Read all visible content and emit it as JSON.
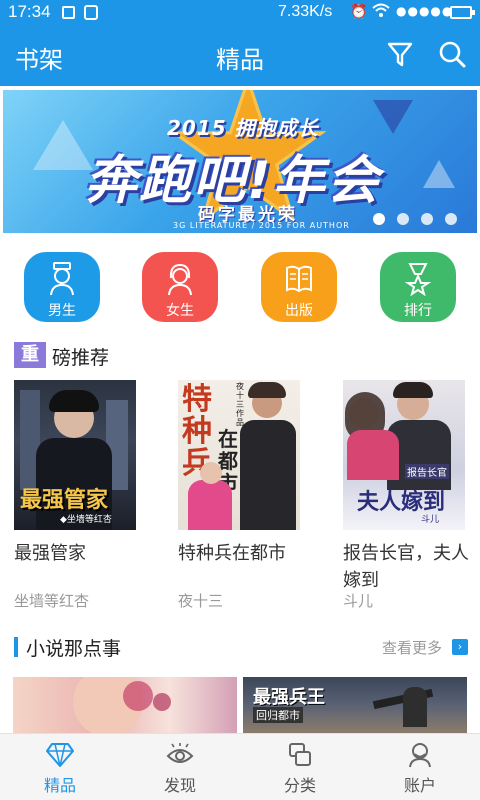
{
  "status_bar": {
    "time": "17:34",
    "network_speed": "7.33K/s",
    "signal": "●●●●●"
  },
  "app_bar": {
    "shelf_label": "书架",
    "title": "精品",
    "filter_icon": "filter-icon",
    "search_icon": "search-icon",
    "color": "#1e96e8"
  },
  "banner": {
    "headline_small": "2015 拥抱成长",
    "headline_main": "奔跑吧!年会",
    "subtitle": "码字最光荣",
    "tagline": "3G LITERATURE / 2015  FOR AUTHOR",
    "page_count": 4,
    "active_page": 1
  },
  "categories": [
    {
      "label": "男生",
      "color": "#1e9be6",
      "icon": "male-avatar-icon"
    },
    {
      "label": "女生",
      "color": "#f4544f",
      "icon": "female-avatar-icon"
    },
    {
      "label": "出版",
      "color": "#f9a01b",
      "icon": "book-icon"
    },
    {
      "label": "排行",
      "color": "#3fba6a",
      "icon": "medal-icon"
    }
  ],
  "recommend": {
    "tag": "重",
    "title_rest": "磅推荐",
    "books": [
      {
        "title": "最强管家",
        "author": "坐墙等红杏",
        "cover_text": "最强管家",
        "cover_small": "◆坐墙等红杏"
      },
      {
        "title": "特种兵在都市",
        "author": "夜十三",
        "cover_text": "特种兵",
        "cover_text2": "在都市",
        "cover_small": "夜十三作品"
      },
      {
        "title": "报告长官，夫人嫁到",
        "author": "斗儿",
        "cover_text": "夫人嫁到",
        "cover_small": "报告长官",
        "cover_author": "斗儿"
      }
    ]
  },
  "stories": {
    "title": "小说那点事",
    "more_label": "查看更多",
    "items": [
      {
        "text": ""
      },
      {
        "text": "最强兵王",
        "sub": "回归都市"
      }
    ]
  },
  "bottom_nav": [
    {
      "label": "精品",
      "icon": "diamond-icon",
      "active": true
    },
    {
      "label": "发现",
      "icon": "eye-icon",
      "active": false
    },
    {
      "label": "分类",
      "icon": "category-icon",
      "active": false
    },
    {
      "label": "账户",
      "icon": "user-icon",
      "active": false
    }
  ]
}
